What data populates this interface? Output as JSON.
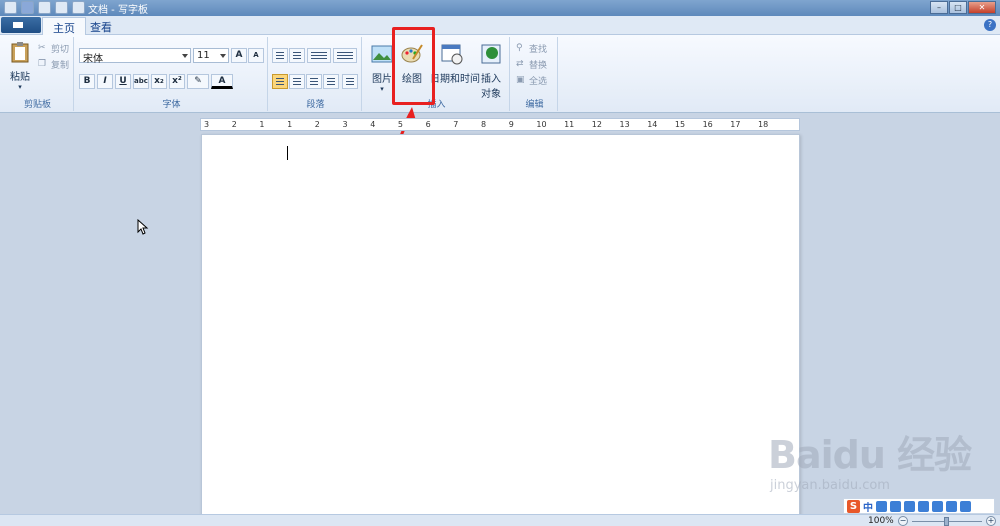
{
  "window": {
    "title": "文档 - 写字板"
  },
  "tabs": {
    "home": "主页",
    "view": "查看"
  },
  "clipboard": {
    "group_label": "剪贴板",
    "paste": "粘贴",
    "cut": "剪切",
    "copy": "复制"
  },
  "font": {
    "group_label": "字体",
    "family": "宋体",
    "size": "11"
  },
  "paragraph": {
    "group_label": "段落"
  },
  "insert": {
    "group_label": "插入",
    "picture": "图片",
    "paint": "绘图",
    "datetime": "日期和时间",
    "object_line1": "插入",
    "object_line2": "对象"
  },
  "editing": {
    "group_label": "编辑",
    "find": "查找",
    "replace": "替换",
    "select_all": "全选"
  },
  "ruler": {
    "labels": [
      "3",
      "2",
      "1",
      "1",
      "2",
      "3",
      "4",
      "5",
      "6",
      "7",
      "8",
      "9",
      "10",
      "11",
      "12",
      "13",
      "14",
      "15",
      "16",
      "17",
      "18"
    ]
  },
  "statusbar": {
    "zoom": "100%"
  },
  "ime": {
    "logo": "S",
    "mode": "中"
  },
  "watermark": {
    "logo": "Baidu 经验",
    "url": "jingyan.baidu.com"
  },
  "colors": {
    "annotation": "#e82020",
    "accent": "#15428b"
  }
}
